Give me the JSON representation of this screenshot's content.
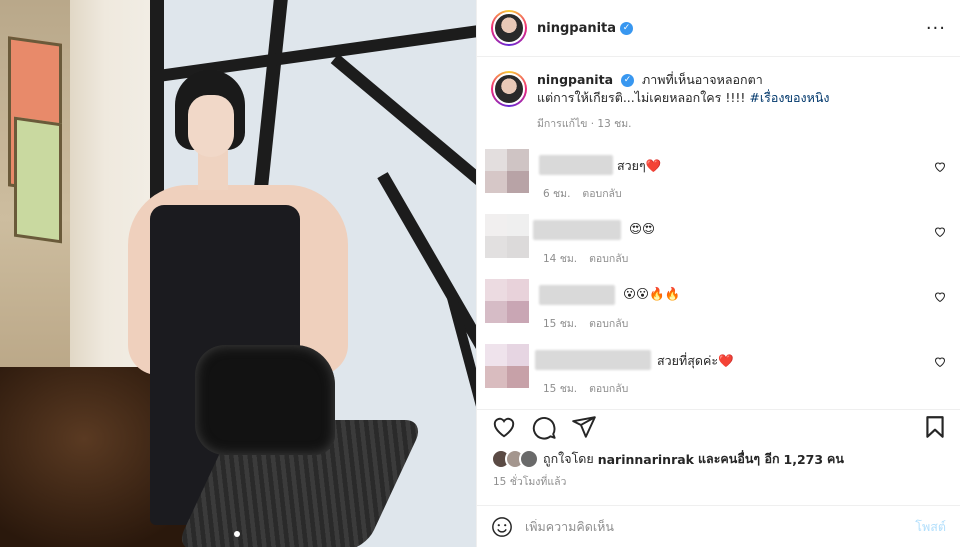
{
  "post": {
    "username": "ningpanita",
    "verified_icon": "verified-badge-icon",
    "more_icon": "more-options-icon"
  },
  "caption": {
    "username": "ningpanita",
    "text_line1": "ภาพที่เห็นอาจหลอกตา",
    "text_line2": "แต่การให้เกียรติ...ไม่เคยหลอกใคร !!!!",
    "hashtag": "#เรื่องของหนิง",
    "edited": "มีการแก้ไข · 13 ชม."
  },
  "comments": [
    {
      "text": "สวยๆ❤️",
      "time": "6 ชม.",
      "reply": "ตอบกลับ"
    },
    {
      "text": "😍😍",
      "time": "14 ชม.",
      "reply": "ตอบกลับ"
    },
    {
      "text": "😮😮🔥🔥",
      "time": "15 ชม.",
      "reply": "ตอบกลับ"
    },
    {
      "text": "สวยที่สุดค่ะ❤️",
      "time": "15 ชม.",
      "reply": "ตอบกลับ"
    }
  ],
  "likes": {
    "prefix": "ถูกใจโดย",
    "user": "narinnarinrak",
    "middle": "และคนอื่นๆ อีก",
    "count": "1,273",
    "suffix": "คน"
  },
  "timestamp": "15 ชั่วโมงที่แล้ว",
  "compose": {
    "placeholder": "เพิ่มความคิดเห็น",
    "post_label": "โพสต์"
  },
  "colors": {
    "link": "#00376b",
    "verified": "#3897f0",
    "muted": "#8e8e8e",
    "post_disabled": "#b2dffc"
  }
}
